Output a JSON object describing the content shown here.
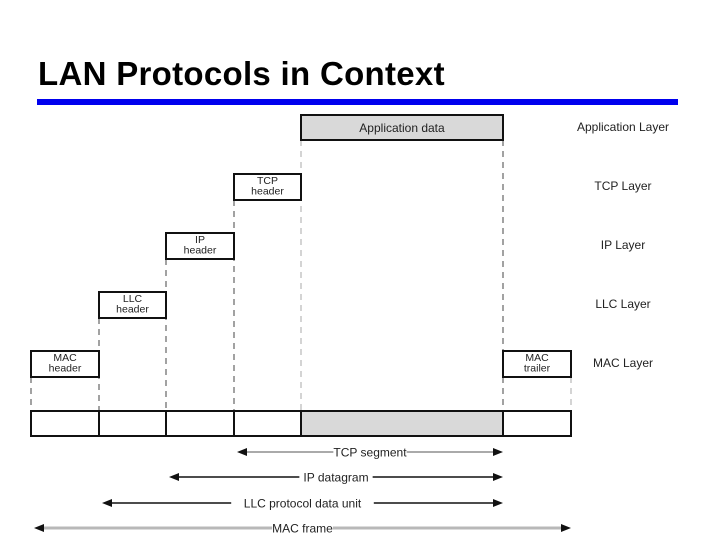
{
  "title": "LAN Protocols in Context",
  "colors": {
    "rule": "#0000ee",
    "box_border": "#111111",
    "data_fill": "#d9d9d9",
    "dash": "#444444",
    "arrow_black": "#111111",
    "arrow_gray": "#b8b8b8"
  },
  "headers": [
    {
      "id": "application-data",
      "lines": [
        "Application data"
      ],
      "shaded": true
    },
    {
      "id": "tcp-header",
      "lines": [
        "TCP",
        "header"
      ],
      "shaded": false
    },
    {
      "id": "ip-header",
      "lines": [
        "IP",
        "header"
      ],
      "shaded": false
    },
    {
      "id": "llc-header",
      "lines": [
        "LLC",
        "header"
      ],
      "shaded": false
    },
    {
      "id": "mac-header",
      "lines": [
        "MAC",
        "header"
      ],
      "shaded": false
    },
    {
      "id": "mac-trailer",
      "lines": [
        "MAC",
        "trailer"
      ],
      "shaded": false
    }
  ],
  "layers": [
    "Application Layer",
    "TCP Layer",
    "IP Layer",
    "LLC Layer",
    "MAC Layer"
  ],
  "frame_cells": [
    "MAC header",
    "LLC header",
    "IP header",
    "TCP header",
    "Application data",
    "MAC trailer"
  ],
  "spans": [
    {
      "label": "TCP segment",
      "from": "TCP header",
      "to": "Application data",
      "style": "dark"
    },
    {
      "label": "IP datagram",
      "from": "IP header",
      "to": "Application data",
      "style": "black"
    },
    {
      "label": "LLC protocol data unit",
      "from": "LLC header",
      "to": "Application data",
      "style": "black"
    },
    {
      "label": "MAC frame",
      "from": "MAC header",
      "to": "MAC trailer",
      "style": "gray"
    }
  ]
}
